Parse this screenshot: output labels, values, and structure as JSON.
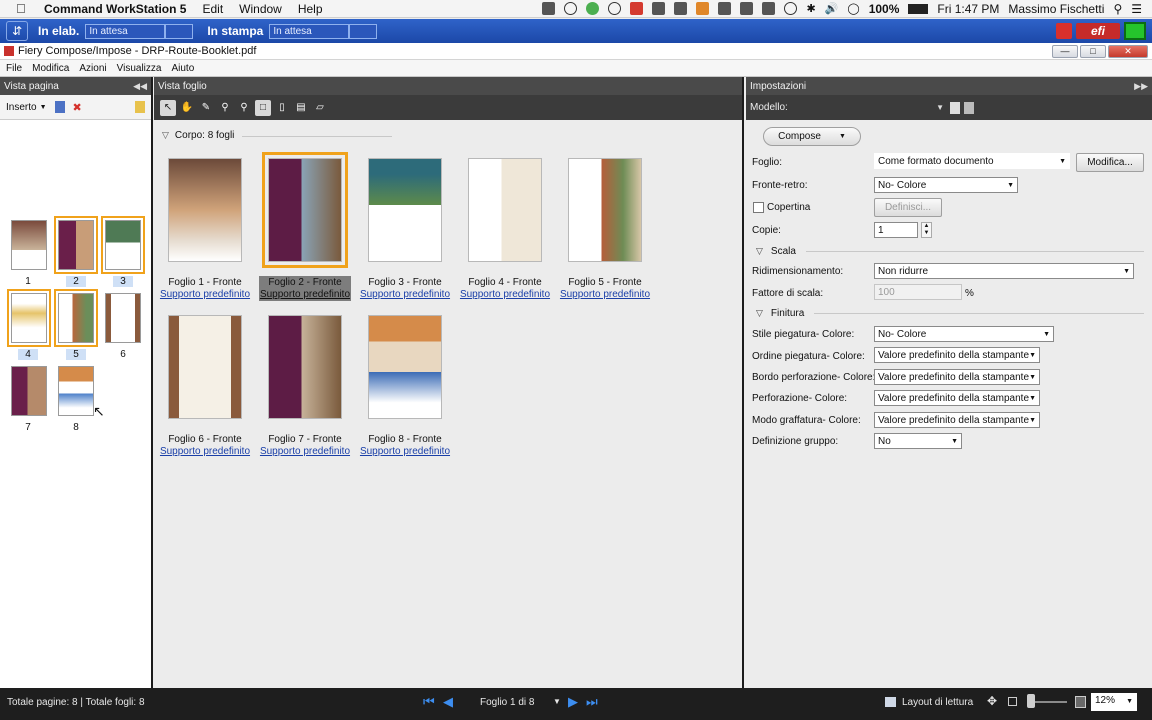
{
  "macbar": {
    "app_name": "Command WorkStation 5",
    "menus": [
      "Edit",
      "Window",
      "Help"
    ],
    "battery": "100%",
    "clock": "Fri 1:47 PM",
    "user": "Massimo Fischetti"
  },
  "status": {
    "processing_label": "In elab.",
    "processing_value": "In attesa",
    "printing_label": "In stampa",
    "printing_value": "In attesa",
    "logo_text": "efi"
  },
  "window": {
    "title": "Fiery Compose/Impose - DRP-Route-Booklet.pdf"
  },
  "appmenu": [
    "File",
    "Modifica",
    "Azioni",
    "Visualizza",
    "Aiuto"
  ],
  "left_panel": {
    "title": "Vista pagina",
    "insert_label": "Inserto",
    "page_numbers": [
      "1",
      "2",
      "3",
      "4",
      "5",
      "6",
      "7",
      "8"
    ]
  },
  "mid_panel": {
    "title": "Vista foglio",
    "group_label": "Corpo: 8 fogli",
    "sheets": [
      {
        "label": "Foglio 1 - Fronte",
        "media": "Supporto predefinito"
      },
      {
        "label": "Foglio 2 - Fronte",
        "media": "Supporto predefinito"
      },
      {
        "label": "Foglio 3 - Fronte",
        "media": "Supporto predefinito"
      },
      {
        "label": "Foglio 4 - Fronte",
        "media": "Supporto predefinito"
      },
      {
        "label": "Foglio 5 - Fronte",
        "media": "Supporto predefinito"
      },
      {
        "label": "Foglio 6 - Fronte",
        "media": "Supporto predefinito"
      },
      {
        "label": "Foglio 7 - Fronte",
        "media": "Supporto predefinito"
      },
      {
        "label": "Foglio 8 - Fronte",
        "media": "Supporto predefinito"
      }
    ]
  },
  "right_panel": {
    "title": "Impostazioni",
    "model_label": "Modello:",
    "mode": "Compose",
    "sheet_label": "Foglio:",
    "sheet_value": "Come formato documento",
    "modify_button": "Modifica...",
    "duplex_label": "Fronte-retro:",
    "duplex_value": "No- Colore",
    "cover_label": "Copertina",
    "define_button": "Definisci...",
    "copies_label": "Copie:",
    "copies_value": "1",
    "scale_section": "Scala",
    "resize_label": "Ridimensionamento:",
    "resize_value": "Non ridurre",
    "scale_factor_label": "Fattore di scala:",
    "scale_factor_value": "100",
    "scale_unit": "%",
    "finishing_section": "Finitura",
    "fold_style_label": "Stile piegatura- Colore:",
    "fold_style_value": "No- Colore",
    "fold_order_label": "Ordine piegatura- Colore:",
    "fold_order_value": "Valore predefinito della stampante",
    "punch_edge_label": "Bordo perforazione- Colore:",
    "punch_edge_value": "Valore predefinito della stampante",
    "punch_label": "Perforazione- Colore:",
    "punch_value": "Valore predefinito della stampante",
    "staple_label": "Modo graffatura- Colore:",
    "staple_value": "Valore predefinito della stampante",
    "group_def_label": "Definizione gruppo:",
    "group_def_value": "No"
  },
  "bottom": {
    "totals": "Totale pagine: 8 | Totale fogli: 8",
    "pager": "Foglio 1 di 8",
    "layout_label": "Layout di lettura",
    "zoom": "12%"
  },
  "colors": {
    "selection": "#f0a21b",
    "status_blue": "#1c48a8",
    "link": "#1a3fa8"
  }
}
